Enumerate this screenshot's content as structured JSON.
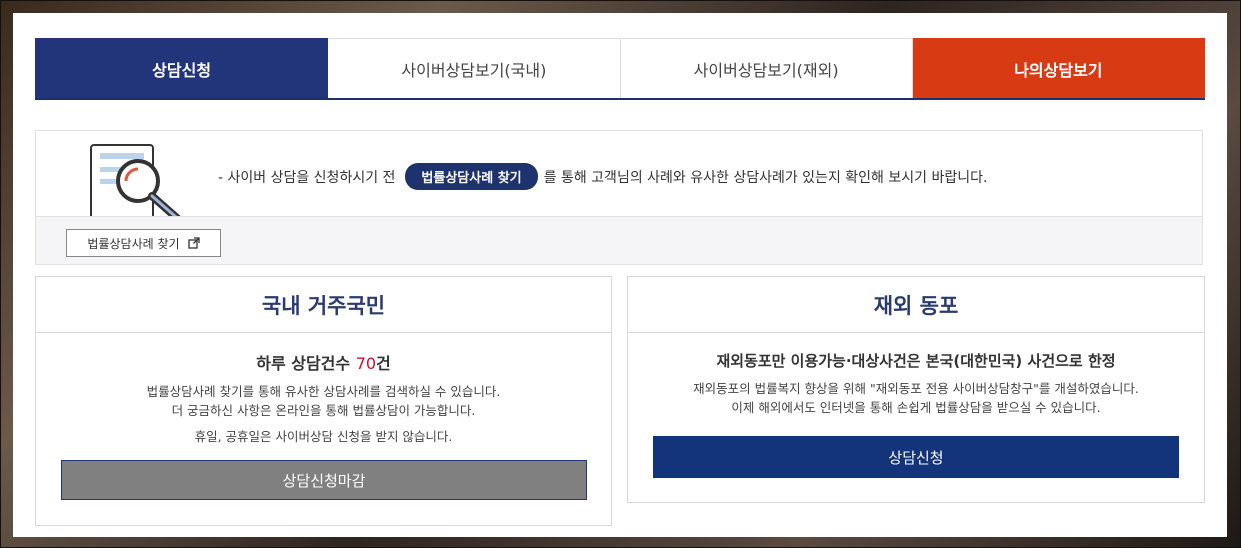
{
  "tabs": [
    {
      "label": "상담신청"
    },
    {
      "label": "사이버상담보기(국내)"
    },
    {
      "label": "사이버상담보기(재외)"
    },
    {
      "label": "나의상담보기"
    }
  ],
  "notice": {
    "prefix": "- 사이버 상담을 신청하시기 전",
    "pill": "법률상담사례 찾기",
    "suffix": "를 통해 고객님의 사례와 유사한 상담사례가 있는지 확인해 보시기 바랍니다.",
    "button": "법률상담사례 찾기"
  },
  "domestic": {
    "title": "국내 거주국민",
    "count_prefix": "하루 상담건수 ",
    "count_value": "70",
    "count_suffix": "건",
    "desc_line1": "법률상담사례 찾기를 통해 유사한 상담사례를 검색하실 수 있습니다.",
    "desc_line2": "더 궁금하신 사항은 온라인을 통해 법률상담이 가능합니다.",
    "desc_line3": "휴일, 공휴일은 사이버상담 신청을 받지 않습니다.",
    "button": "상담신청마감"
  },
  "overseas": {
    "title": "재외 동포",
    "subtitle": "재외동포만 이용가능·대상사건은 본국(대한민국) 사건으로 한정",
    "desc_line1": "재외동포의 법률복지 향상을 위해 \"재외동포 전용 사이버상담창구\"를 개설하였습니다.",
    "desc_line2": "이제 해외에서도 인터넷을 통해 손쉽게 법률상담을 받으실 수 있습니다.",
    "button": "상담신청"
  },
  "colors": {
    "navy": "#22357a",
    "orange": "#d83a13",
    "count_red": "#c8102e",
    "closed_gray": "#808080"
  }
}
